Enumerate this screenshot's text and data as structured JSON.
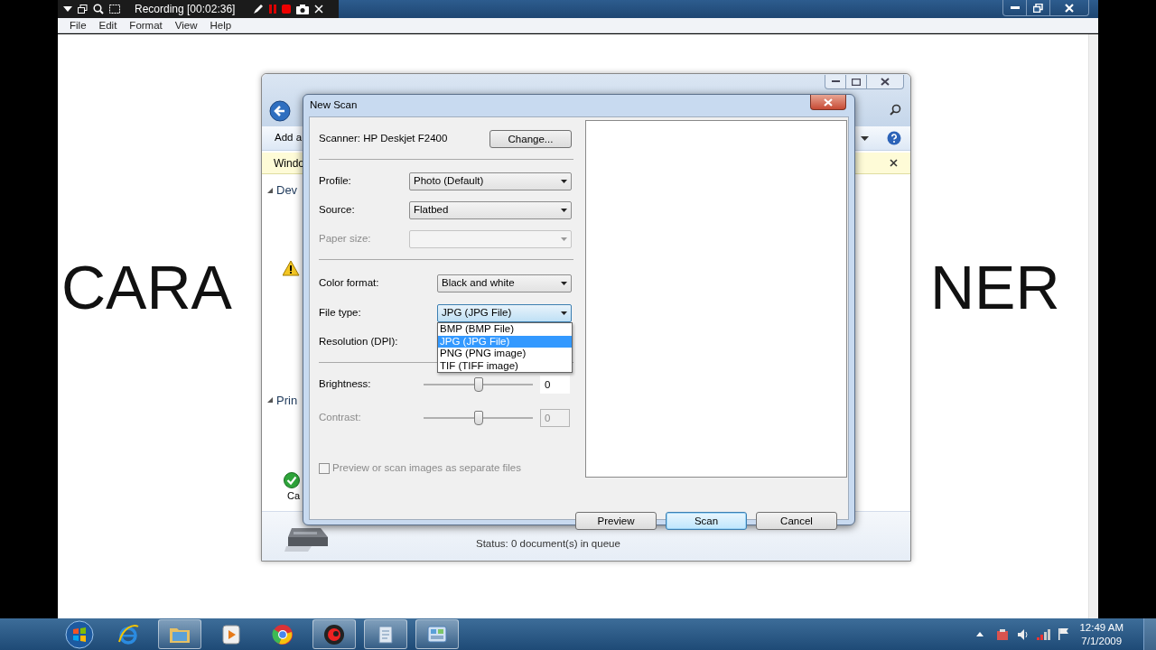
{
  "recorder": {
    "status": "Recording [00:02:36]"
  },
  "editor": {
    "menu": [
      "File",
      "Edit",
      "Format",
      "View",
      "Help"
    ],
    "document_text": [
      "CARA",
      "NER"
    ]
  },
  "devices_window": {
    "toolbar_text": "Add a",
    "info_bar": "Windo",
    "groups": [
      {
        "label": "Dev"
      },
      {
        "label": "Prin"
      }
    ],
    "item_label": "Ca",
    "status": "Status: 0 document(s) in queue"
  },
  "dialog": {
    "title": "New Scan",
    "scanner": "Scanner: HP Deskjet F2400",
    "change_button": "Change...",
    "sections": [
      [
        {
          "kind": "select",
          "label": "Profile:",
          "value": "Photo (Default)",
          "disabled": false
        },
        {
          "kind": "select",
          "label": "Source:",
          "value": "Flatbed",
          "disabled": false
        },
        {
          "kind": "select",
          "label": "Paper size:",
          "disabled": true
        }
      ],
      [
        {
          "kind": "select",
          "label": "Color format:",
          "value": "Black and white",
          "disabled": false
        },
        {
          "kind": "select",
          "label": "File type:",
          "value": "JPG (JPG File)",
          "disabled": false,
          "open": true,
          "options": [
            {
              "label": "BMP (BMP File)",
              "selected": false
            },
            {
              "label": "JPG (JPG File)",
              "selected": true
            },
            {
              "label": "PNG (PNG image)",
              "selected": false
            },
            {
              "label": "TIF (TIFF image)",
              "selected": false
            }
          ]
        },
        {
          "kind": "covered",
          "label": "Resolution (DPI):"
        }
      ],
      [
        {
          "kind": "slider",
          "label": "Brightness:",
          "level": 0.5,
          "reading": "0",
          "disabled": false
        },
        {
          "kind": "slider",
          "label": "Contrast:",
          "level": 0.5,
          "reading": "0",
          "disabled": true
        }
      ]
    ],
    "checkbox": {
      "label": "Preview or scan images as separate files",
      "checked": false
    },
    "buttons": [
      {
        "label": "Preview",
        "default": false
      },
      {
        "label": "Scan",
        "default": true
      },
      {
        "label": "Cancel",
        "default": false
      }
    ]
  },
  "taskbar": {
    "apps": [
      {
        "kind": "browser",
        "open": false
      },
      {
        "kind": "folder",
        "open": true
      },
      {
        "kind": "media",
        "open": false
      },
      {
        "kind": "chrome",
        "open": false
      },
      {
        "kind": "recorder",
        "open": true
      },
      {
        "kind": "notepad",
        "open": true
      },
      {
        "kind": "control-panel",
        "open": true
      }
    ],
    "time": "12:49 AM",
    "date": "7/1/2009"
  }
}
